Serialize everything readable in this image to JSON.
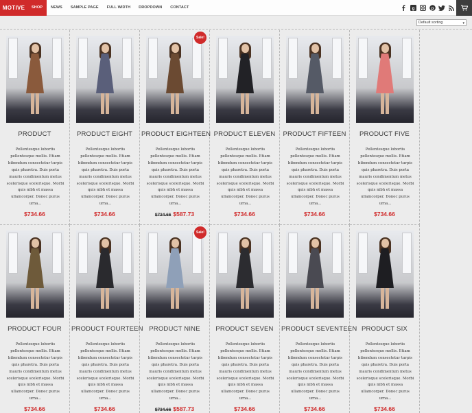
{
  "nav": {
    "logo": "MOTIVE",
    "items": [
      {
        "label": "SHOP",
        "active": true
      },
      {
        "label": "NEWS",
        "active": false
      },
      {
        "label": "SAMPLE PAGE",
        "active": false
      },
      {
        "label": "FULL WIDTH",
        "active": false
      },
      {
        "label": "DROPDOWN",
        "active": false
      },
      {
        "label": "CONTACT",
        "active": false
      }
    ],
    "social_icons": [
      "facebook-icon",
      "google-plus-icon",
      "instagram-icon",
      "pinterest-icon",
      "twitter-icon",
      "rss-icon"
    ],
    "cart_icon": "cart-icon"
  },
  "sorting": {
    "selected": "Default sorting"
  },
  "colors": {
    "accent": "#d02a2a",
    "nav_dark": "#3d3d3d",
    "background": "#ececec"
  },
  "description": "Pellentesque lobortis pellentesque mollis. Etiam bibendum consectetur turpis quis pharetra. Duis porta mauris condimentum metus scelerisque scelerisque. Morbi quis nibh et massa ullamcorper. Donec purus urna...",
  "products": [
    {
      "name": "PRODUCT",
      "price": "$734.66",
      "old_price": "",
      "sale": false,
      "sale_label": "",
      "dress": "#8a5a3c"
    },
    {
      "name": "PRODUCT EIGHT",
      "price": "$734.66",
      "old_price": "",
      "sale": false,
      "sale_label": "",
      "dress": "#5a5f7a"
    },
    {
      "name": "PRODUCT EIGHTEEN",
      "price": "$587.73",
      "old_price": "$734.66",
      "sale": true,
      "sale_label": "Sale!",
      "dress": "#6b4a32"
    },
    {
      "name": "PRODUCT ELEVEN",
      "price": "$734.66",
      "old_price": "",
      "sale": false,
      "sale_label": "",
      "dress": "#222226"
    },
    {
      "name": "PRODUCT FIFTEEN",
      "price": "$734.66",
      "old_price": "",
      "sale": false,
      "sale_label": "",
      "dress": "#555a66"
    },
    {
      "name": "PRODUCT FIVE",
      "price": "$734.66",
      "old_price": "",
      "sale": false,
      "sale_label": "",
      "dress": "#e07a78"
    },
    {
      "name": "PRODUCT FOUR",
      "price": "$734.66",
      "old_price": "",
      "sale": false,
      "sale_label": "",
      "dress": "#6e5a3a"
    },
    {
      "name": "PRODUCT FOURTEEN",
      "price": "$734.66",
      "old_price": "",
      "sale": false,
      "sale_label": "",
      "dress": "#2a2a2e"
    },
    {
      "name": "PRODUCT NINE",
      "price": "$587.73",
      "old_price": "$734.66",
      "sale": true,
      "sale_label": "Sale!",
      "dress": "#8fa0b8"
    },
    {
      "name": "PRODUCT SEVEN",
      "price": "$734.66",
      "old_price": "",
      "sale": false,
      "sale_label": "",
      "dress": "#2c2c30"
    },
    {
      "name": "PRODUCT SEVENTEEN",
      "price": "$734.66",
      "old_price": "",
      "sale": false,
      "sale_label": "",
      "dress": "#4a4a52"
    },
    {
      "name": "PRODUCT SIX",
      "price": "$734.66",
      "old_price": "",
      "sale": false,
      "sale_label": "",
      "dress": "#1e1e22"
    }
  ]
}
